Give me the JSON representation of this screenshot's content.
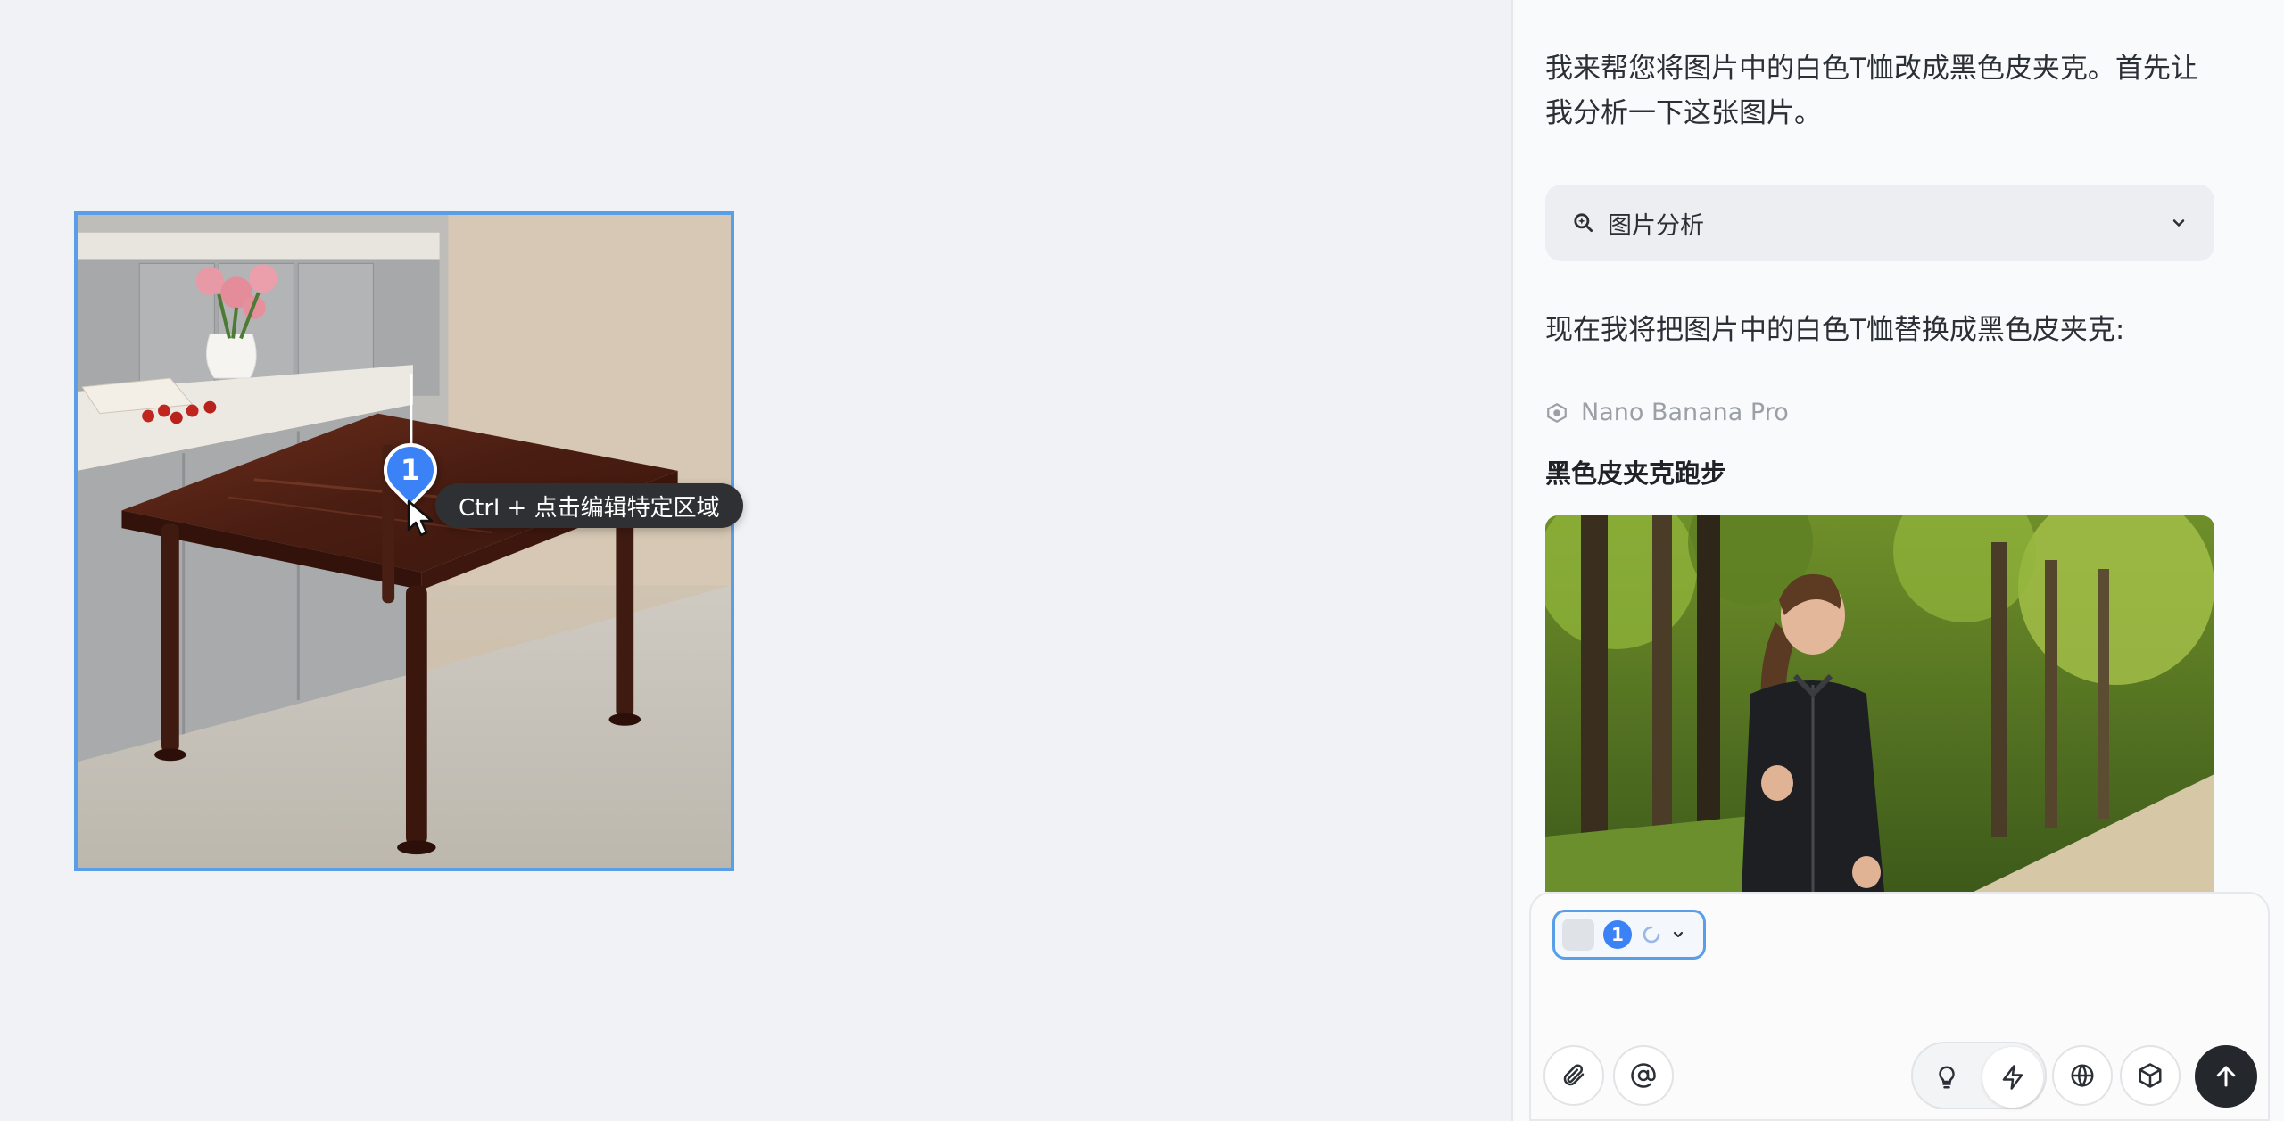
{
  "canvas": {
    "tooltip": "Ctrl + 点击编辑特定区域",
    "marker_number": "1"
  },
  "chat": {
    "intro": "我来帮您将图片中的白色T恤改成黑色皮夹克。首先让我分析一下这张图片。",
    "analysis_label": "图片分析",
    "replace_text": "现在我将把图片中的白色T恤替换成黑色皮夹克:",
    "model_name": "Nano Banana Pro",
    "result_title": "黑色皮夹克跑步"
  },
  "composer": {
    "ref_number": "1"
  },
  "icons": {
    "analysis": "search-spark-icon",
    "model": "eye-icon",
    "attach": "paperclip-icon",
    "mention": "at-icon",
    "idea": "lightbulb-icon",
    "fast": "lightning-icon",
    "web": "globe-icon",
    "model3d": "cube-icon",
    "send": "arrow-up-icon"
  },
  "colors": {
    "accent": "#3b82f6",
    "selection_border": "#5b9ee8",
    "send_button": "#24272c",
    "tooltip_bg": "#2f3033"
  }
}
